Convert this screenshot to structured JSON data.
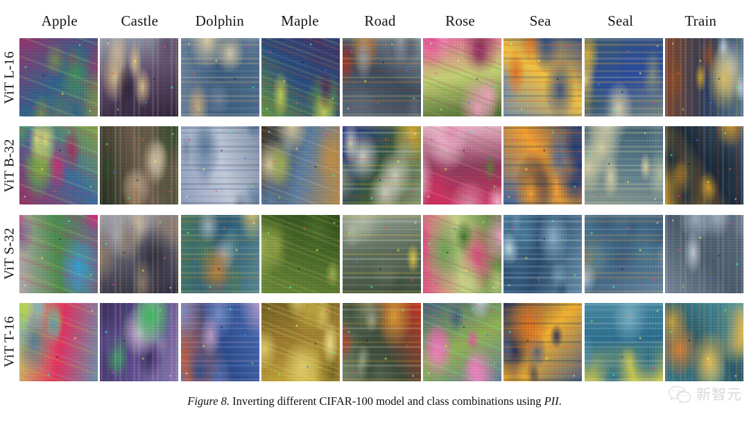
{
  "figure": {
    "background_color": "#ffffff",
    "caption_label": "Figure 8.",
    "caption_text": "Inverting different CIFAR-100 model and class combinations using",
    "caption_emphasis": "PII",
    "caption_end": "."
  },
  "columns": [
    {
      "label": "Apple"
    },
    {
      "label": "Castle"
    },
    {
      "label": "Dolphin"
    },
    {
      "label": "Maple"
    },
    {
      "label": "Road"
    },
    {
      "label": "Rose"
    },
    {
      "label": "Sea"
    },
    {
      "label": "Seal"
    },
    {
      "label": "Train"
    }
  ],
  "rows": [
    {
      "label": "ViT L-16"
    },
    {
      "label": "ViT B-32"
    },
    {
      "label": "ViT S-32"
    },
    {
      "label": "ViT T-16"
    }
  ],
  "watermark": {
    "icon": "wechat-icon",
    "text": "新智元",
    "color": "#d2d2d2"
  },
  "grid": {
    "rows": 4,
    "columns": 9,
    "cell_size_px": 113,
    "cells": [
      {
        "row": "ViT L-16",
        "column": "Apple",
        "palette": [
          "#7a8a4e",
          "#b8324f",
          "#2f5f8a",
          "#d8e060",
          "#9a2f6a",
          "#3f8f5a"
        ],
        "motif": "apples-cluster"
      },
      {
        "row": "ViT L-16",
        "column": "Castle",
        "palette": [
          "#9aa7b4",
          "#c8b49a",
          "#5a4a6a",
          "#d8c08a",
          "#2a2036",
          "#8a5a3a"
        ],
        "motif": "castle-facade"
      },
      {
        "row": "ViT L-16",
        "column": "Dolphin",
        "palette": [
          "#6a7f9a",
          "#c8a878",
          "#3a5a7a",
          "#e0d0a8",
          "#4a6a88",
          "#8a9ab0"
        ],
        "motif": "dolphin-water"
      },
      {
        "row": "ViT L-16",
        "column": "Maple",
        "palette": [
          "#6a9a3a",
          "#d05a2a",
          "#2a4a7a",
          "#c8d050",
          "#4a2a5a",
          "#7ac0e0"
        ],
        "motif": "maple-foliage"
      },
      {
        "row": "ViT L-16",
        "column": "Road",
        "palette": [
          "#8a9aa8",
          "#d07a2a",
          "#3a4a5a",
          "#e0c070",
          "#5a6a7a",
          "#b03020"
        ],
        "motif": "road-vehicles"
      },
      {
        "row": "ViT L-16",
        "column": "Rose",
        "palette": [
          "#e85a9a",
          "#5a8a3a",
          "#c0d070",
          "#8a2a5a",
          "#3a5a2a",
          "#f0a0c0"
        ],
        "motif": "rose-blooms"
      },
      {
        "row": "ViT L-16",
        "column": "Sea",
        "palette": [
          "#2a4a8a",
          "#e07020",
          "#f0c040",
          "#1a2a5a",
          "#6a8ab0",
          "#d03010"
        ],
        "motif": "sea-sunset"
      },
      {
        "row": "ViT L-16",
        "column": "Seal",
        "palette": [
          "#7a8a7a",
          "#e0b030",
          "#2a4a9a",
          "#d8d0b0",
          "#3a5a6a",
          "#f0d060"
        ],
        "motif": "seal-body"
      },
      {
        "row": "ViT L-16",
        "column": "Train",
        "palette": [
          "#5a7a8a",
          "#d0a030",
          "#2a3a5a",
          "#c0d0d8",
          "#8a4a2a",
          "#e0c060"
        ],
        "motif": "train-carriage"
      },
      {
        "row": "ViT B-32",
        "column": "Apple",
        "palette": [
          "#8aa83a",
          "#d02a6a",
          "#3a6a9a",
          "#e0e070",
          "#a02a5a",
          "#50a050"
        ],
        "motif": "apples-cluster"
      },
      {
        "row": "ViT B-32",
        "column": "Castle",
        "palette": [
          "#2a4a2a",
          "#c8b8a0",
          "#6a5a4a",
          "#d8c8a8",
          "#1a2a1a",
          "#9a7a5a"
        ],
        "motif": "castle-facade"
      },
      {
        "row": "ViT B-32",
        "column": "Dolphin",
        "palette": [
          "#7a8aa0",
          "#4a6a9a",
          "#c0c8d8",
          "#2a3a5a",
          "#8a9ab8",
          "#5a7a98"
        ],
        "motif": "dolphin-leap"
      },
      {
        "row": "ViT B-32",
        "column": "Maple",
        "palette": [
          "#c08a40",
          "#8aa03a",
          "#5a7aa0",
          "#e0d0a0",
          "#3a2a1a",
          "#a0b050"
        ],
        "motif": "maple-tree"
      },
      {
        "row": "ViT B-32",
        "column": "Road",
        "palette": [
          "#8a9a7a",
          "#d0d0c0",
          "#3a5a3a",
          "#e0b030",
          "#2030a0",
          "#d03020"
        ],
        "motif": "road-cars"
      },
      {
        "row": "ViT B-32",
        "column": "Rose",
        "palette": [
          "#d03060",
          "#e090b0",
          "#8a3a5a",
          "#5a7a3a",
          "#f0c0d0",
          "#a02040"
        ],
        "motif": "rose-spiral"
      },
      {
        "row": "ViT B-32",
        "column": "Sea",
        "palette": [
          "#1a3a7a",
          "#e06020",
          "#f0a030",
          "#0a1a4a",
          "#4a6a9a",
          "#c02010"
        ],
        "motif": "sea-sunset"
      },
      {
        "row": "ViT B-32",
        "column": "Seal",
        "palette": [
          "#8a9a8a",
          "#d8d0a0",
          "#5a7a8a",
          "#e0d8b8",
          "#3a5a6a",
          "#b0c0a0"
        ],
        "motif": "seal-body"
      },
      {
        "row": "ViT B-32",
        "column": "Train",
        "palette": [
          "#4a5a6a",
          "#d03020",
          "#1a2a3a",
          "#c0c8d0",
          "#e0a020",
          "#7a8a9a"
        ],
        "motif": "train-engine"
      },
      {
        "row": "ViT S-32",
        "column": "Apple",
        "palette": [
          "#c0a8b0",
          "#e02070",
          "#4a8a4a",
          "#d8d070",
          "#7a5a8a",
          "#30a0d0"
        ],
        "motif": "apples-scatter"
      },
      {
        "row": "ViT S-32",
        "column": "Castle",
        "palette": [
          "#a8a8b0",
          "#c8b8a0",
          "#5a5a6a",
          "#e0c050",
          "#2a2a3a",
          "#8a7a6a"
        ],
        "motif": "castle-noise"
      },
      {
        "row": "ViT S-32",
        "column": "Dolphin",
        "palette": [
          "#5a8a8a",
          "#c08030",
          "#2a5a7a",
          "#d0c070",
          "#4a7a5a",
          "#a0b0c0"
        ],
        "motif": "dolphin-abstract"
      },
      {
        "row": "ViT S-32",
        "column": "Maple",
        "palette": [
          "#6a8a3a",
          "#a0b050",
          "#4a6a2a",
          "#d0c060",
          "#2a4a1a",
          "#8a9a40"
        ],
        "motif": "maple-canopy"
      },
      {
        "row": "ViT S-32",
        "column": "Road",
        "palette": [
          "#9aa89a",
          "#d0d8c0",
          "#5a6a5a",
          "#e0c840",
          "#3a4a3a",
          "#b0b8a0"
        ],
        "motif": "road-curve"
      },
      {
        "row": "ViT S-32",
        "column": "Rose",
        "palette": [
          "#e04080",
          "#60a050",
          "#c0d080",
          "#8a3a6a",
          "#3a6a2a",
          "#f0a0c8"
        ],
        "motif": "rose-petals"
      },
      {
        "row": "ViT S-32",
        "column": "Sea",
        "palette": [
          "#4a7a9a",
          "#c0d8e0",
          "#2a4a6a",
          "#8ab0c8",
          "#6a90a8",
          "#d8e8f0"
        ],
        "motif": "sea-surface"
      },
      {
        "row": "ViT S-32",
        "column": "Seal",
        "palette": [
          "#6a8aa0",
          "#d09040",
          "#3a5a7a",
          "#e0b060",
          "#4a7a90",
          "#b0c8d8"
        ],
        "motif": "seal-rock"
      },
      {
        "row": "ViT S-32",
        "column": "Train",
        "palette": [
          "#7a8a9a",
          "#a0b0c0",
          "#4a5a6a",
          "#c8d0d8",
          "#5a6a7a",
          "#90a0b0"
        ],
        "motif": "train-track"
      },
      {
        "row": "ViT T-16",
        "column": "Apple",
        "palette": [
          "#5a9ab0",
          "#a8d040",
          "#e03060",
          "#7ab8c8",
          "#c8e060",
          "#4a7a90"
        ],
        "motif": "apple-single"
      },
      {
        "row": "ViT T-16",
        "column": "Castle",
        "palette": [
          "#8a7ab0",
          "#c8b0c8",
          "#5a4a8a",
          "#d8c8d8",
          "#3a2a5a",
          "#30c050"
        ],
        "motif": "castle-building"
      },
      {
        "row": "ViT T-16",
        "column": "Dolphin",
        "palette": [
          "#4a6ab0",
          "#7a90c8",
          "#2a4a8a",
          "#c0a0c8",
          "#e06030",
          "#90a8d0"
        ],
        "motif": "dolphin-leap"
      },
      {
        "row": "ViT T-16",
        "column": "Maple",
        "palette": [
          "#d8c040",
          "#e0d070",
          "#a08030",
          "#f0e090",
          "#6a5a20",
          "#c0a840"
        ],
        "motif": "maple-autumn"
      },
      {
        "row": "ViT T-16",
        "column": "Road",
        "palette": [
          "#7a8a6a",
          "#c8c0a0",
          "#3a4a3a",
          "#e0a030",
          "#d03020",
          "#a0b090"
        ],
        "motif": "road-perspective"
      },
      {
        "row": "ViT T-16",
        "column": "Rose",
        "palette": [
          "#5a7a9a",
          "#e050a0",
          "#8ab050",
          "#c0d0e0",
          "#3a5a7a",
          "#f080c0"
        ],
        "motif": "rose-stem"
      },
      {
        "row": "ViT T-16",
        "column": "Sea",
        "palette": [
          "#1a2a5a",
          "#e07020",
          "#f0b030",
          "#0a1a3a",
          "#3a5a8a",
          "#d04010"
        ],
        "motif": "sea-sunset"
      },
      {
        "row": "ViT T-16",
        "column": "Seal",
        "palette": [
          "#4a8aa0",
          "#7ab0c0",
          "#2a6a8a",
          "#c0d8e0",
          "#e0d040",
          "#90c0d0"
        ],
        "motif": "seal-water"
      },
      {
        "row": "ViT T-16",
        "column": "Train",
        "palette": [
          "#3a7a8a",
          "#e08030",
          "#2a5a6a",
          "#d0a040",
          "#50a0b0",
          "#f0c050"
        ],
        "motif": "train-side"
      }
    ]
  }
}
